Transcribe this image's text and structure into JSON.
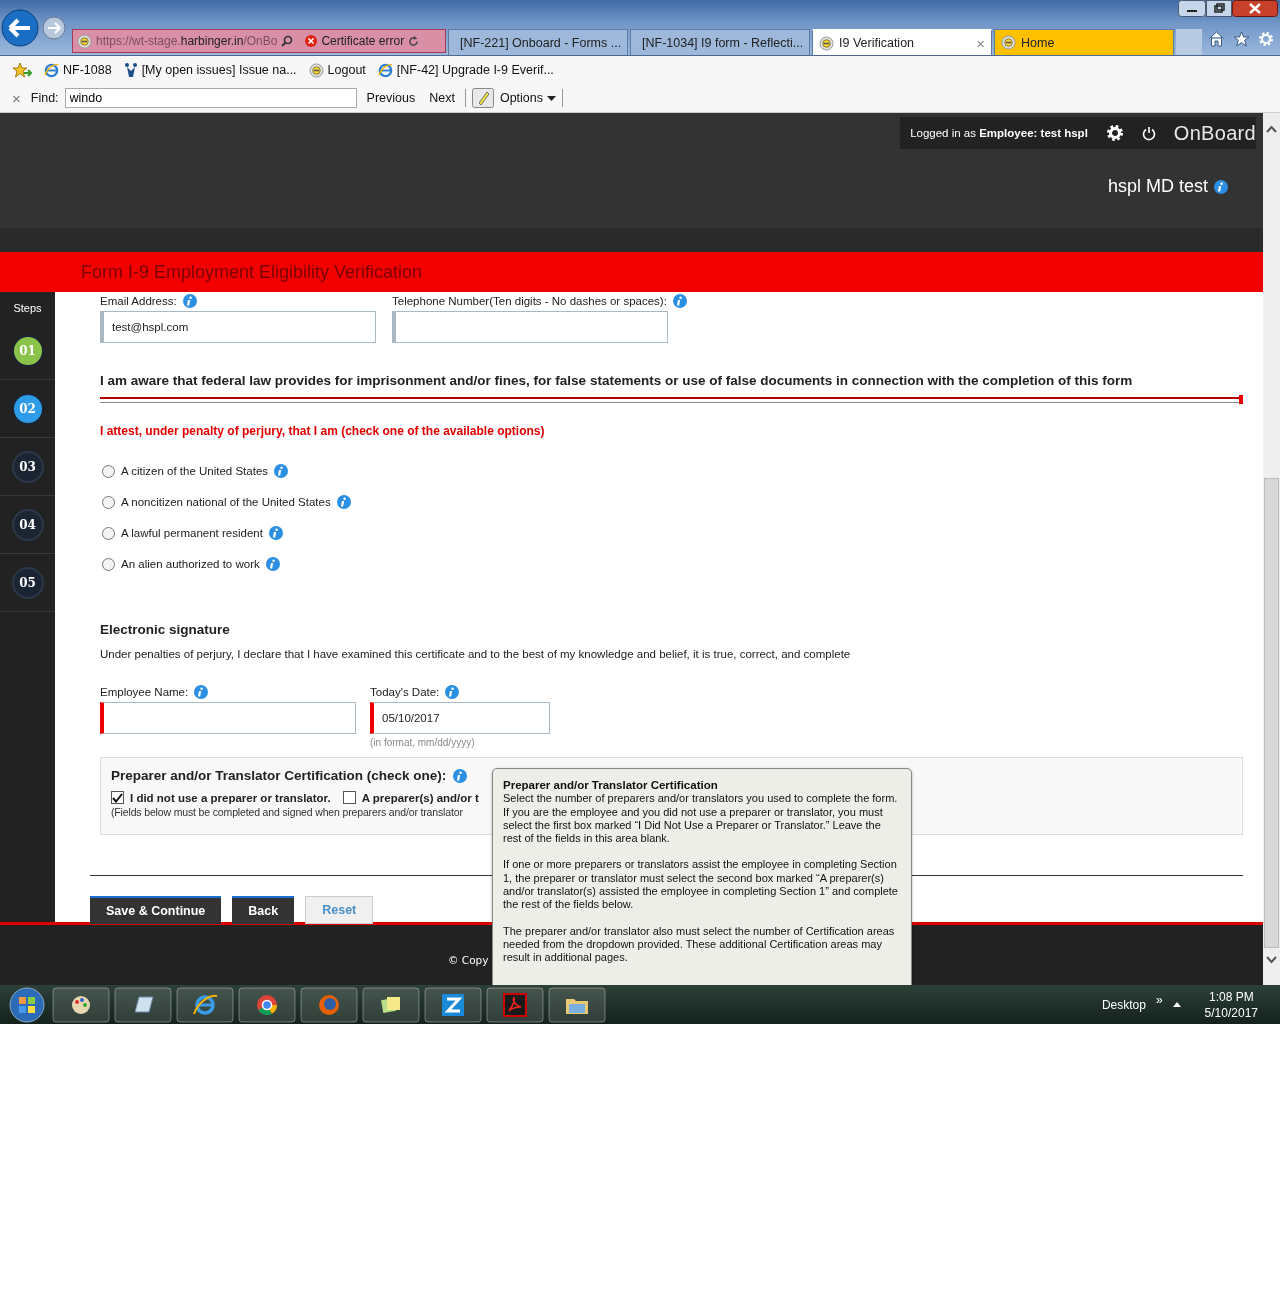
{
  "browser": {
    "url_prefix": "https://wt-stage.",
    "url_domain": "harbinger.in",
    "url_suffix": "/OnBo",
    "certificate_error": "Certificate error",
    "tabs": [
      {
        "label": "[NF-221] Onboard - Forms ...",
        "kind": "jira",
        "selected": false,
        "highlighted": false
      },
      {
        "label": "[NF-1034] I9 form - Reflecti...",
        "kind": "jira",
        "selected": false,
        "highlighted": false
      },
      {
        "label": "I9 Verification",
        "kind": "site",
        "selected": true,
        "highlighted": false,
        "close": "×"
      },
      {
        "label": "Home",
        "kind": "site",
        "selected": false,
        "highlighted": true
      }
    ],
    "favorites": [
      {
        "label": "NF-1088",
        "kind": "ie"
      },
      {
        "label": "[My open issues] Issue na...",
        "kind": "jira"
      },
      {
        "label": "Logout",
        "kind": "site"
      },
      {
        "label": "[NF-42] Upgrade I-9 Everif...",
        "kind": "ie"
      }
    ],
    "find": {
      "close": "×",
      "label": "Find:",
      "value": "windo",
      "previous": "Previous",
      "next": "Next",
      "options": "Options"
    }
  },
  "header": {
    "logged_in": "Logged in as **Employee:  test hspl**",
    "app_name": "OnBoard",
    "company": "hspl MD test"
  },
  "page_title": "Form I-9 Employment Eligibility Verification",
  "steps_label": "Steps",
  "steps": [
    {
      "label": "01",
      "completed": true,
      "selected": false
    },
    {
      "label": "02",
      "completed": false,
      "selected": true
    },
    {
      "label": "03",
      "completed": false,
      "selected": false
    },
    {
      "label": "04",
      "completed": false,
      "selected": false
    },
    {
      "label": "05",
      "completed": false,
      "selected": false
    }
  ],
  "contact": [
    {
      "label": "Email Address:",
      "value": "test@hspl.com"
    },
    {
      "label": "Telephone Number(Ten digits - No dashes or spaces):"
    }
  ],
  "awareness": "I am aware that federal law provides for imprisonment and/or fines, for false statements or use of false documents in connection with the completion of this form",
  "attest": "I attest, under penalty of perjury, that I am (check one of the available options)",
  "status_options": [
    {
      "label": "A citizen of the United States",
      "selected": false
    },
    {
      "label": "A noncitizen national of the United States",
      "selected": false
    },
    {
      "label": "A lawful permanent resident",
      "selected": false
    },
    {
      "label": "An alien authorized to work",
      "selected": false
    }
  ],
  "signature": {
    "title": "Electronic signature",
    "declaration": "Under penalties of perjury, I declare that I have examined this certificate and to the best of my knowledge and belief, it is true, correct, and complete",
    "employee_name": {
      "label": "Employee Name:"
    },
    "todays_date": {
      "label": "Today's Date:",
      "value": "05/10/2017",
      "hint": "(in format, mm/dd/yyyy)"
    }
  },
  "preparer": {
    "title": "Preparer and/or Translator Certification (check one):",
    "options": [
      {
        "label": "I did not use a preparer or translator.",
        "checked": true
      },
      {
        "label": "A preparer(s) and/or t",
        "checked": false
      }
    ],
    "note": "(Fields below must be completed and signed when preparers and/or translator"
  },
  "buttons": [
    {
      "label": "Save & Continue",
      "kind": "primary"
    },
    {
      "label": "Back",
      "kind": "secondary"
    },
    {
      "label": "Reset",
      "kind": "light"
    }
  ],
  "footer": "© Copy",
  "tooltip": {
    "title": "Preparer and/or Translator Certification",
    "paragraphs": [
      "Select the number of preparers and/or translators you used to complete the form. If you are the employee and you did not use a preparer or translator, you must select the first box marked “I Did Not Use a Preparer or Translator.” Leave the rest of the fields in this area blank.",
      "If one or more preparers or translators assist the employee in completing Section 1, the preparer or translator must select the second box marked “A preparer(s) and/or translator(s) assisted the employee in completing Section 1” and complete the rest of the fields below.",
      "The preparer and/or translator also must select the number of Certification areas needed from the dropdown provided. These additional Certification areas may result in additional pages."
    ]
  },
  "taskbar": {
    "apps": [
      {
        "kind": "paint"
      },
      {
        "kind": "notes"
      },
      {
        "kind": "ie"
      },
      {
        "kind": "chrome"
      },
      {
        "kind": "firefox"
      },
      {
        "kind": "sticky"
      },
      {
        "kind": "z"
      },
      {
        "kind": "pdf"
      },
      {
        "kind": "folder"
      }
    ],
    "desktop": "Desktop",
    "chevron": "»",
    "time": "1:08 PM",
    "date": "5/10/2017"
  }
}
